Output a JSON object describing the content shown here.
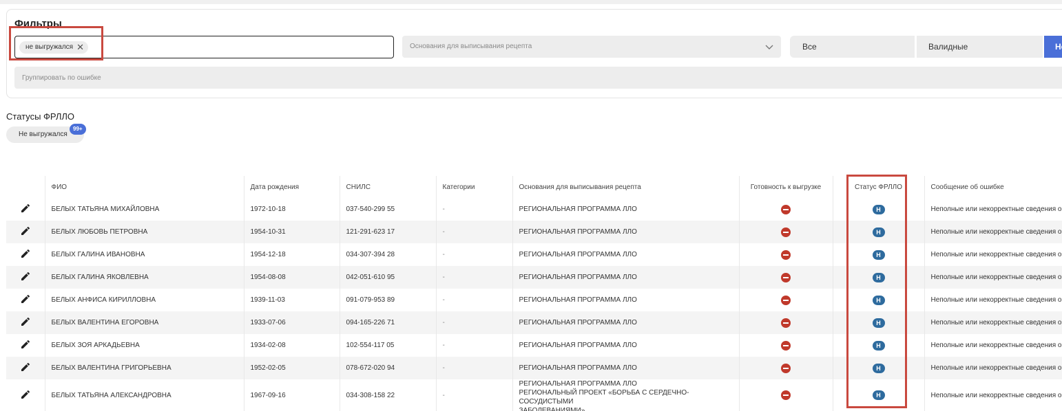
{
  "filters": {
    "title": "Фильтры",
    "export_chip": "не выгружался",
    "reason_placeholder": "Основания для выписывания рецепта",
    "group_placeholder": "Группировать по ошибке",
    "segments": {
      "all": "Все",
      "valid": "Валидные",
      "active": "Не"
    }
  },
  "statuses": {
    "title": "Статусы ФРЛЛО",
    "chip_label": "Не выгружался",
    "chip_count": "99+"
  },
  "table": {
    "headers": {
      "fio": "ФИО",
      "dob": "Дата рождения",
      "snils": "СНИЛС",
      "categories": "Категории",
      "reason": "Основания для выписывания рецепта",
      "ready": "Готовность к выгрузке",
      "status": "Статус ФРЛЛО",
      "error": "Сообщение об ошибке"
    },
    "status_letter": "Н",
    "rows": [
      {
        "fio": "БЕЛЫХ ТАТЬЯНА МИХАЙЛОВНА",
        "dob": "1972-10-18",
        "snils": "037-540-299 55",
        "cat": "-",
        "reason": "РЕГИОНАЛЬНАЯ ПРОГРАММА ЛЛО",
        "reason2": "",
        "reason3": "",
        "error": "Неполные или некорректные сведения об"
      },
      {
        "fio": "БЕЛЫХ ЛЮБОВЬ ПЕТРОВНА",
        "dob": "1954-10-31",
        "snils": "121-291-623 17",
        "cat": "-",
        "reason": "РЕГИОНАЛЬНАЯ ПРОГРАММА ЛЛО",
        "reason2": "",
        "reason3": "",
        "error": "Неполные или некорректные сведения об"
      },
      {
        "fio": "БЕЛЫХ ГАЛИНА ИВАНОВНА",
        "dob": "1954-12-18",
        "snils": "034-307-394 28",
        "cat": "-",
        "reason": "РЕГИОНАЛЬНАЯ ПРОГРАММА ЛЛО",
        "reason2": "",
        "reason3": "",
        "error": "Неполные или некорректные сведения об"
      },
      {
        "fio": "БЕЛЫХ ГАЛИНА ЯКОВЛЕВНА",
        "dob": "1954-08-08",
        "snils": "042-051-610 95",
        "cat": "-",
        "reason": "РЕГИОНАЛЬНАЯ ПРОГРАММА ЛЛО",
        "reason2": "",
        "reason3": "",
        "error": "Неполные или некорректные сведения об"
      },
      {
        "fio": "БЕЛЫХ АНФИСА КИРИЛЛОВНА",
        "dob": "1939-11-03",
        "snils": "091-079-953 89",
        "cat": "-",
        "reason": "РЕГИОНАЛЬНАЯ ПРОГРАММА ЛЛО",
        "reason2": "",
        "reason3": "",
        "error": "Неполные или некорректные сведения об"
      },
      {
        "fio": "БЕЛЫХ ВАЛЕНТИНА ЕГОРОВНА",
        "dob": "1933-07-06",
        "snils": "094-165-226 71",
        "cat": "-",
        "reason": "РЕГИОНАЛЬНАЯ ПРОГРАММА ЛЛО",
        "reason2": "",
        "reason3": "",
        "error": "Неполные или некорректные сведения об"
      },
      {
        "fio": "БЕЛЫХ ЗОЯ АРКАДЬЕВНА",
        "dob": "1934-02-08",
        "snils": "102-554-117 05",
        "cat": "-",
        "reason": "РЕГИОНАЛЬНАЯ ПРОГРАММА ЛЛО",
        "reason2": "",
        "reason3": "",
        "error": "Неполные или некорректные сведения об"
      },
      {
        "fio": "БЕЛЫХ ВАЛЕНТИНА ГРИГОРЬЕВНА",
        "dob": "1952-02-05",
        "snils": "078-672-020 94",
        "cat": "-",
        "reason": "РЕГИОНАЛЬНАЯ ПРОГРАММА ЛЛО",
        "reason2": "",
        "reason3": "",
        "error": "Неполные или некорректные сведения об"
      },
      {
        "fio": "БЕЛЫХ ТАТЬЯНА АЛЕКСАНДРОВНА",
        "dob": "1967-09-16",
        "snils": "034-308-158 22",
        "cat": "-",
        "reason": "РЕГИОНАЛЬНАЯ ПРОГРАММА ЛЛО",
        "reason2": "РЕГИОНАЛЬНЫЙ ПРОЕКТ «БОРЬБА С СЕРДЕЧНО-СОСУДИСТЫМИ",
        "reason3": "ЗАБОЛЕВАНИЯМИ»",
        "error": "Неполные или некорректные сведения об"
      }
    ]
  },
  "colors": {
    "accent": "#4a6fd8",
    "highlight": "#c9493f",
    "error_icon": "#c0392b",
    "status_badge": "#2e6b9e"
  },
  "icons": {
    "edit": "pencil-icon",
    "not_ready": "minus-circle-icon",
    "chip_remove": "close-icon",
    "dropdown": "chevron-down-icon"
  }
}
